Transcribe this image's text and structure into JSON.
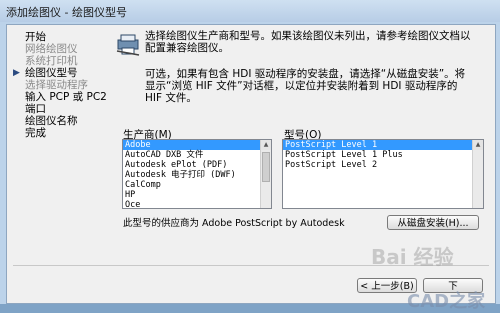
{
  "window": {
    "title": "添加绘图仪 - 绘图仪型号"
  },
  "nav": {
    "items": [
      {
        "label": "开始",
        "state": "normal"
      },
      {
        "label": "网络绘图仪",
        "state": "dim"
      },
      {
        "label": "系统打印机",
        "state": "dim"
      },
      {
        "label": "绘图仪型号",
        "state": "current"
      },
      {
        "label": "选择驱动程序",
        "state": "dim"
      },
      {
        "label": "输入 PCP 或 PC2",
        "state": "normal"
      },
      {
        "label": "端口",
        "state": "normal"
      },
      {
        "label": "绘图仪名称",
        "state": "normal"
      },
      {
        "label": "完成",
        "state": "normal"
      }
    ]
  },
  "content": {
    "description_line1": "选择绘图仪生产商和型号。如果该绘图仪未列出，请参考绘图仪文档以",
    "description_line2": "配置兼容绘图仪。",
    "hint_line1": "可选，如果有包含 HDI 驱动程序的安装盘，请选择“从磁盘安装”。将",
    "hint_line2": "显示“浏览 HIF 文件”对话框，以定位并安装附着到 HDI 驱动程序的",
    "hint_line3": "HIF 文件。",
    "manufacturer_label": "生产商(M)",
    "model_label": "型号(O)",
    "manufacturers": [
      "Adobe",
      "AutoCAD DXB 文件",
      "Autodesk ePlot (PDF)",
      "Autodesk 电子打印 (DWF)",
      "CalComp",
      "HP",
      "Oce"
    ],
    "selected_manufacturer": "Adobe",
    "models": [
      "PostScript Level 1",
      "PostScript Level 1 Plus",
      "PostScript Level 2"
    ],
    "selected_model": "PostScript Level 1",
    "supplier_text": "此型号的供应商为 Adobe PostScript by Autodesk",
    "install_from_disk_label": "从磁盘安装(H)..."
  },
  "footer": {
    "back_label": "< 上一步(B)",
    "next_label": "下"
  },
  "watermark": {
    "text1": "Bai 经验",
    "text2": "CAD之家"
  }
}
